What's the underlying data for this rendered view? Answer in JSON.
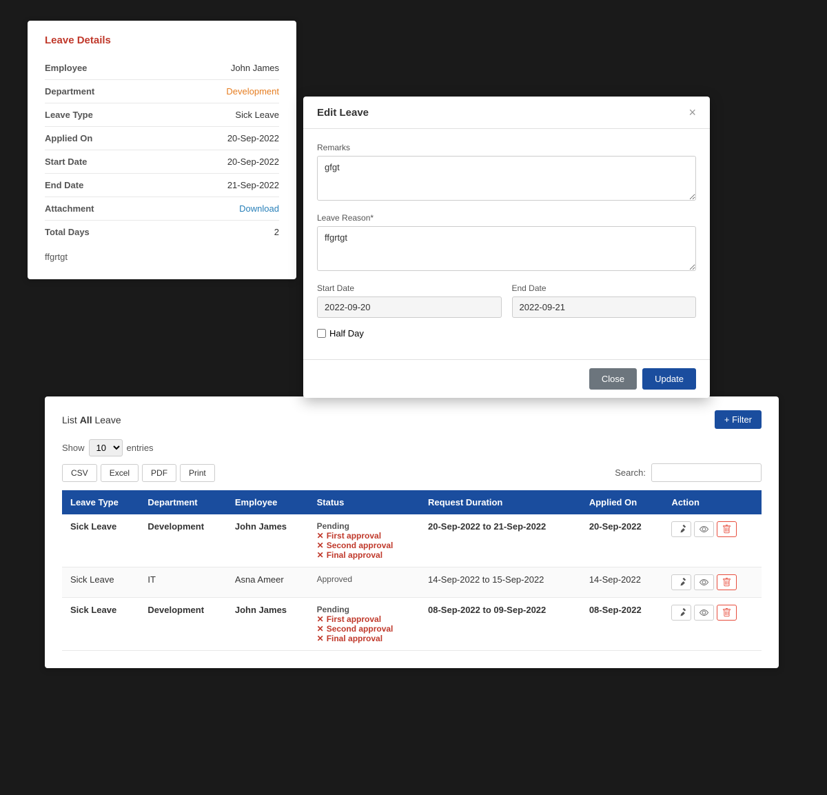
{
  "leaveDetails": {
    "title": "Leave Details",
    "fields": [
      {
        "label": "Employee",
        "value": "John James",
        "valueClass": ""
      },
      {
        "label": "Department",
        "value": "Development",
        "valueClass": "orange"
      },
      {
        "label": "Leave Type",
        "value": "Sick Leave",
        "valueClass": ""
      },
      {
        "label": "Applied On",
        "value": "20-Sep-2022",
        "valueClass": ""
      },
      {
        "label": "Start Date",
        "value": "20-Sep-2022",
        "valueClass": ""
      },
      {
        "label": "End Date",
        "value": "21-Sep-2022",
        "valueClass": ""
      },
      {
        "label": "Attachment",
        "value": "Download",
        "valueClass": "link"
      },
      {
        "label": "Total Days",
        "value": "2",
        "valueClass": ""
      }
    ],
    "note": "ffgrtgt"
  },
  "editLeave": {
    "title": "Edit Leave",
    "fields": {
      "remarks_label": "Remarks",
      "remarks_value": "gfgt",
      "leave_reason_label": "Leave Reason*",
      "leave_reason_value": "ffgrtgt",
      "start_date_label": "Start Date",
      "start_date_value": "2022-09-20",
      "end_date_label": "End Date",
      "end_date_value": "2022-09-21",
      "half_day_label": "Half Day"
    },
    "close_btn": "Close",
    "update_btn": "Update"
  },
  "listPanel": {
    "title_prefix": "List",
    "title_bold": "All",
    "title_suffix": "Leave",
    "filter_btn": "+ Filter",
    "show_label": "Show",
    "show_value": "10",
    "entries_label": "entries",
    "export_buttons": [
      "CSV",
      "Excel",
      "PDF",
      "Print"
    ],
    "search_label": "Search:",
    "table": {
      "headers": [
        "Leave Type",
        "Department",
        "Employee",
        "Status",
        "Request Duration",
        "Applied On",
        "Action"
      ],
      "rows": [
        {
          "leaveType": "Sick Leave",
          "department": "Development",
          "employee": "John James",
          "statusMain": "Pending",
          "approvals": [
            "First approval",
            "Second approval",
            "Final approval"
          ],
          "requestDuration": "20-Sep-2022 to 21-Sep-2022",
          "appliedOn": "20-Sep-2022",
          "bold": true
        },
        {
          "leaveType": "Sick Leave",
          "department": "IT",
          "employee": "Asna Ameer",
          "statusMain": "Approved",
          "approvals": [],
          "requestDuration": "14-Sep-2022 to 15-Sep-2022",
          "appliedOn": "14-Sep-2022",
          "bold": false
        },
        {
          "leaveType": "Sick Leave",
          "department": "Development",
          "employee": "John James",
          "statusMain": "Pending",
          "approvals": [
            "First approval",
            "Second approval",
            "Final approval"
          ],
          "requestDuration": "08-Sep-2022 to 09-Sep-2022",
          "appliedOn": "08-Sep-2022",
          "bold": true
        }
      ]
    }
  }
}
